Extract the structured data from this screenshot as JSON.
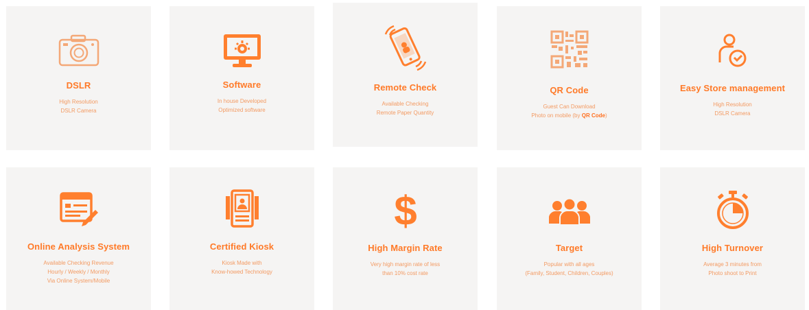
{
  "accent": "#ff7d2c",
  "features": [
    {
      "title": "DSLR",
      "icon": "camera-icon",
      "desc": [
        "High Resolution",
        "DSLR Camera"
      ]
    },
    {
      "title": "Software",
      "icon": "monitor-gear-icon",
      "desc": [
        "In house Developed",
        "Optimized software"
      ]
    },
    {
      "title": "Remote Check",
      "icon": "phone-signal-icon",
      "desc": [
        "Available Checking",
        "Remote Paper Quantity"
      ]
    },
    {
      "title": "QR Code",
      "icon": "qr-code-icon",
      "desc": [
        "Guest Can Download",
        "Photo on mobile (by"
      ],
      "desc_bold": "QR Code",
      "desc_tail": ")"
    },
    {
      "title": "Easy Store management",
      "icon": "user-check-icon",
      "desc": [
        "High Resolution",
        "DSLR Camera"
      ]
    },
    {
      "title": "Online Analysis System",
      "icon": "browser-edit-icon",
      "desc": [
        "Available Checking Revenue",
        "Hourly / Weekly / Monthly",
        "Via Online System/Mobile"
      ]
    },
    {
      "title": "Certified Kiosk",
      "icon": "kiosk-icon",
      "desc": [
        "Kiosk Made with",
        "Know-howed Technology"
      ]
    },
    {
      "title": "High Margin Rate",
      "icon": "dollar-icon",
      "desc": [
        "Very high margin rate of less",
        "than 10% cost rate"
      ]
    },
    {
      "title": "Target",
      "icon": "group-icon",
      "desc": [
        "Popular with all ages",
        "(Family, Student, Children, Couples)"
      ]
    },
    {
      "title": "High Turnover",
      "icon": "stopwatch-icon",
      "desc": [
        "Average 3 minutes from",
        "Photo shoot to Print"
      ]
    }
  ]
}
